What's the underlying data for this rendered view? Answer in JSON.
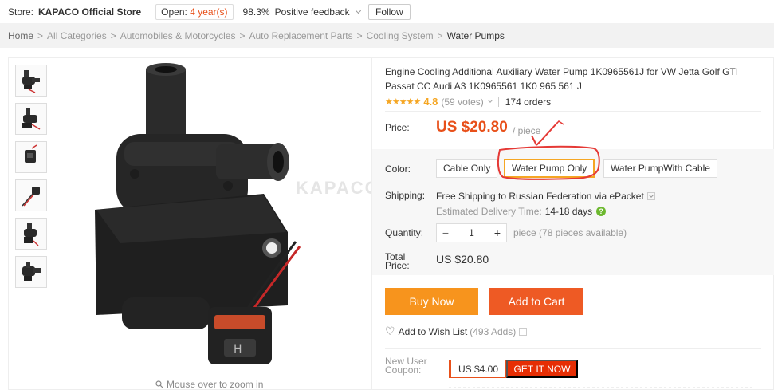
{
  "store": {
    "label": "Store:",
    "name": "KAPACO Official Store",
    "open_prefix": "Open:",
    "open_years": "4 year(s)",
    "feedback_pct": "98.3%",
    "feedback_text": "Positive feedback",
    "follow_label": "Follow"
  },
  "breadcrumb": [
    "Home",
    "All Categories",
    "Automobiles & Motorcycles",
    "Auto Replacement Parts",
    "Cooling System",
    "Water Pumps"
  ],
  "gallery": {
    "thumbnails": [
      "pump-thumb-1",
      "pump-thumb-2",
      "connector-thumb",
      "cable-thumb",
      "pump-thumb-3",
      "pump-thumb-4"
    ],
    "watermark": "KAPACO",
    "zoom_hint": "Mouse over to zoom in"
  },
  "product": {
    "title": "Engine Cooling Additional Auxiliary Water Pump 1K0965561J for VW Jetta Golf GTI Passat CC Audi A3 1K0965561 1K0 965 561 J",
    "stars": "★★★★★",
    "rating": "4.8",
    "votes": "(59 votes)",
    "orders": "174 orders",
    "price_label": "Price:",
    "price": "US $20.80",
    "price_unit": "/ piece",
    "color_label": "Color:",
    "colors": [
      "Cable Only",
      "Water Pump Only",
      "Water PumpWith Cable"
    ],
    "selected_color": "Water Pump Only",
    "shipping_label": "Shipping:",
    "shipping_text": "Free Shipping to Russian Federation via ePacket",
    "delivery_label": "Estimated Delivery Time:",
    "delivery_days": "14-18 days",
    "quantity_label": "Quantity:",
    "quantity": "1",
    "quantity_avail": "piece (78 pieces available)",
    "total_label_1": "Total",
    "total_label_2": "Price:",
    "total": "US $20.80",
    "buy_now": "Buy Now",
    "add_to_cart": "Add to Cart",
    "wishlist": "Add to Wish List",
    "wishlist_adds": "(493 Adds)",
    "coupon_label_1": "New User",
    "coupon_label_2": "Coupon:",
    "coupon_amount": "US $4.00",
    "coupon_get": "GET IT NOW"
  },
  "colors": {
    "accent_orange": "#e8501a",
    "buy_now_bg": "#f7941d",
    "cart_bg": "#ee5a24",
    "selected_border": "#f5a623",
    "annotation_red": "#e53935"
  }
}
